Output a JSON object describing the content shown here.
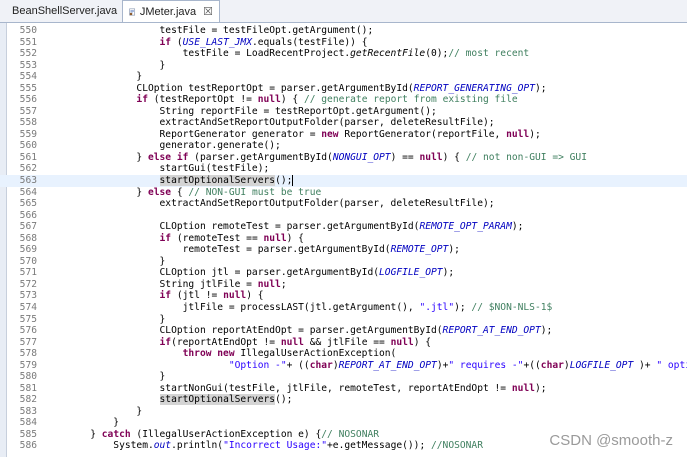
{
  "tabs": [
    {
      "label": "BeanShellServer.java",
      "active": false
    },
    {
      "label": "JMeter.java",
      "active": true,
      "close_label": "☒"
    }
  ],
  "watermark": "CSDN @smooth-z",
  "current_line": 563,
  "lines": [
    {
      "n": "550",
      "t": [
        [
          "",
          "                    testFile = testFileOpt.getArgument();"
        ]
      ]
    },
    {
      "n": "551",
      "t": [
        [
          "",
          "                    "
        ],
        [
          "kw",
          "if"
        ],
        [
          "",
          " ("
        ],
        [
          "fld",
          "USE_LAST_JMX"
        ],
        [
          "",
          ".equals(testFile)) {"
        ]
      ]
    },
    {
      "n": "552",
      "t": [
        [
          "",
          "                        testFile = LoadRecentProject."
        ],
        [
          "smeth",
          "getRecentFile"
        ],
        [
          "",
          "(0);"
        ],
        [
          "cmt",
          "// most recent"
        ]
      ]
    },
    {
      "n": "553",
      "t": [
        [
          "",
          "                    }"
        ]
      ]
    },
    {
      "n": "554",
      "t": [
        [
          "",
          "                }"
        ]
      ]
    },
    {
      "n": "555",
      "t": [
        [
          "",
          "                CLOption testReportOpt = parser.getArgumentById("
        ],
        [
          "fld",
          "REPORT_GENERATING_OPT"
        ],
        [
          "",
          ");"
        ]
      ]
    },
    {
      "n": "556",
      "t": [
        [
          "",
          "                "
        ],
        [
          "kw",
          "if"
        ],
        [
          "",
          " (testReportOpt != "
        ],
        [
          "kw",
          "null"
        ],
        [
          "",
          ") { "
        ],
        [
          "cmt",
          "// generate report from existing file"
        ]
      ]
    },
    {
      "n": "557",
      "t": [
        [
          "",
          "                    String reportFile = testReportOpt.getArgument();"
        ]
      ]
    },
    {
      "n": "558",
      "t": [
        [
          "",
          "                    extractAndSetReportOutputFolder(parser, deleteResultFile);"
        ]
      ]
    },
    {
      "n": "559",
      "t": [
        [
          "",
          "                    ReportGenerator generator = "
        ],
        [
          "kw",
          "new"
        ],
        [
          "",
          " ReportGenerator(reportFile, "
        ],
        [
          "kw",
          "null"
        ],
        [
          "",
          ");"
        ]
      ]
    },
    {
      "n": "560",
      "t": [
        [
          "",
          "                    generator.generate();"
        ]
      ]
    },
    {
      "n": "561",
      "t": [
        [
          "",
          "                } "
        ],
        [
          "kw",
          "else if"
        ],
        [
          "",
          " (parser.getArgumentById("
        ],
        [
          "fld",
          "NONGUI_OPT"
        ],
        [
          "",
          ") == "
        ],
        [
          "kw",
          "null"
        ],
        [
          "",
          ") { "
        ],
        [
          "cmt",
          "// not non-GUI => GUI"
        ]
      ]
    },
    {
      "n": "562",
      "t": [
        [
          "",
          "                    startGui(testFile);"
        ]
      ]
    },
    {
      "n": "563",
      "t": [
        [
          "",
          "                    "
        ],
        [
          "occ",
          "startOptionalServers"
        ],
        [
          "",
          "();"
        ],
        [
          "caret",
          ""
        ]
      ]
    },
    {
      "n": "564",
      "t": [
        [
          "",
          "                } "
        ],
        [
          "kw",
          "else"
        ],
        [
          "",
          " { "
        ],
        [
          "cmt",
          "// NON-GUI must be true"
        ]
      ]
    },
    {
      "n": "565",
      "t": [
        [
          "",
          "                    extractAndSetReportOutputFolder(parser, deleteResultFile);"
        ]
      ]
    },
    {
      "n": "566",
      "t": [
        [
          "",
          ""
        ]
      ]
    },
    {
      "n": "567",
      "t": [
        [
          "",
          "                    CLOption remoteTest = parser.getArgumentById("
        ],
        [
          "fld",
          "REMOTE_OPT_PARAM"
        ],
        [
          "",
          ");"
        ]
      ]
    },
    {
      "n": "568",
      "t": [
        [
          "",
          "                    "
        ],
        [
          "kw",
          "if"
        ],
        [
          "",
          " (remoteTest == "
        ],
        [
          "kw",
          "null"
        ],
        [
          "",
          ") {"
        ]
      ]
    },
    {
      "n": "569",
      "t": [
        [
          "",
          "                        remoteTest = parser.getArgumentById("
        ],
        [
          "fld",
          "REMOTE_OPT"
        ],
        [
          "",
          ");"
        ]
      ]
    },
    {
      "n": "570",
      "t": [
        [
          "",
          "                    }"
        ]
      ]
    },
    {
      "n": "571",
      "t": [
        [
          "",
          "                    CLOption jtl = parser.getArgumentById("
        ],
        [
          "fld",
          "LOGFILE_OPT"
        ],
        [
          "",
          ");"
        ]
      ]
    },
    {
      "n": "572",
      "t": [
        [
          "",
          "                    String jtlFile = "
        ],
        [
          "kw",
          "null"
        ],
        [
          "",
          ";"
        ]
      ]
    },
    {
      "n": "573",
      "t": [
        [
          "",
          "                    "
        ],
        [
          "kw",
          "if"
        ],
        [
          "",
          " (jtl != "
        ],
        [
          "kw",
          "null"
        ],
        [
          "",
          ") {"
        ]
      ]
    },
    {
      "n": "574",
      "t": [
        [
          "",
          "                        jtlFile = processLAST(jtl.getArgument(), "
        ],
        [
          "str",
          "\".jtl\""
        ],
        [
          "",
          "); "
        ],
        [
          "cmt",
          "// $NON-NLS-1$"
        ]
      ]
    },
    {
      "n": "575",
      "t": [
        [
          "",
          "                    }"
        ]
      ]
    },
    {
      "n": "576",
      "t": [
        [
          "",
          "                    CLOption reportAtEndOpt = parser.getArgumentById("
        ],
        [
          "fld",
          "REPORT_AT_END_OPT"
        ],
        [
          "",
          ");"
        ]
      ]
    },
    {
      "n": "577",
      "t": [
        [
          "",
          "                    "
        ],
        [
          "kw",
          "if"
        ],
        [
          "",
          "(reportAtEndOpt != "
        ],
        [
          "kw",
          "null"
        ],
        [
          "",
          " && jtlFile == "
        ],
        [
          "kw",
          "null"
        ],
        [
          "",
          ") {"
        ]
      ]
    },
    {
      "n": "578",
      "t": [
        [
          "",
          "                        "
        ],
        [
          "kw",
          "throw new"
        ],
        [
          "",
          " IllegalUserActionException("
        ]
      ]
    },
    {
      "n": "579",
      "t": [
        [
          "",
          "                                "
        ],
        [
          "str",
          "\"Option -\""
        ],
        [
          "",
          "+ (("
        ],
        [
          "kw",
          "char"
        ],
        [
          "",
          ")"
        ],
        [
          "fld",
          "REPORT_AT_END_OPT"
        ],
        [
          "",
          ")+"
        ],
        [
          "str",
          "\" requires -\""
        ],
        [
          "",
          "+(("
        ],
        [
          "kw",
          "char"
        ],
        [
          "",
          ")"
        ],
        [
          "fld",
          "LOGFILE_OPT"
        ],
        [
          "",
          " )+ "
        ],
        [
          "str",
          "\" option\""
        ],
        [
          "",
          ");"
        ]
      ]
    },
    {
      "n": "580",
      "t": [
        [
          "",
          "                    }"
        ]
      ]
    },
    {
      "n": "581",
      "t": [
        [
          "",
          "                    startNonGui(testFile, jtlFile, remoteTest, reportAtEndOpt != "
        ],
        [
          "kw",
          "null"
        ],
        [
          "",
          ");"
        ]
      ]
    },
    {
      "n": "582",
      "t": [
        [
          "",
          "                    "
        ],
        [
          "occ",
          "startOptionalServers"
        ],
        [
          "",
          "();"
        ]
      ]
    },
    {
      "n": "583",
      "t": [
        [
          "",
          "                }"
        ]
      ]
    },
    {
      "n": "584",
      "t": [
        [
          "",
          "            }"
        ]
      ]
    },
    {
      "n": "585",
      "t": [
        [
          "",
          "        } "
        ],
        [
          "kw",
          "catch"
        ],
        [
          "",
          " (IllegalUserActionException e) {"
        ],
        [
          "cmt",
          "// NOSONAR"
        ]
      ]
    },
    {
      "n": "586",
      "t": [
        [
          "",
          "            System."
        ],
        [
          "fld",
          "out"
        ],
        [
          "",
          ".println("
        ],
        [
          "str",
          "\"Incorrect Usage:\""
        ],
        [
          "",
          "+e.getMessage()); "
        ],
        [
          "cmt",
          "//NOSONAR"
        ]
      ]
    }
  ]
}
